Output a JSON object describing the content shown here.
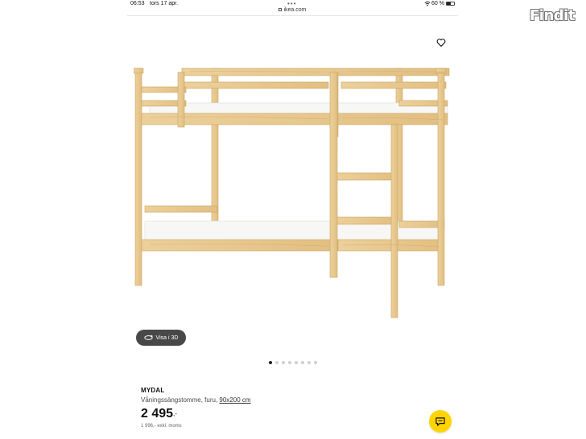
{
  "status_bar": {
    "time": "06:53",
    "date": "tors 17 apr.",
    "dots": "•••",
    "battery": "60 %",
    "battery_level": 0.6
  },
  "browser": {
    "url": "ikea.com"
  },
  "gallery": {
    "view_3d_label": "Visa i 3D",
    "page_count": 8,
    "active_page": 1
  },
  "product": {
    "name": "MYDAL",
    "description": "Våningssängstomme, furu,",
    "size_link": "90x200 cm",
    "price": "2 495",
    "price_suffix": ",-",
    "price_ex_vat": "1 996,- exkl. moms"
  },
  "overlay": {
    "logo": "Findit"
  },
  "colors": {
    "accent_yellow": "#ffd400",
    "button_dark": "#484848",
    "wood": "#e8c98e"
  }
}
